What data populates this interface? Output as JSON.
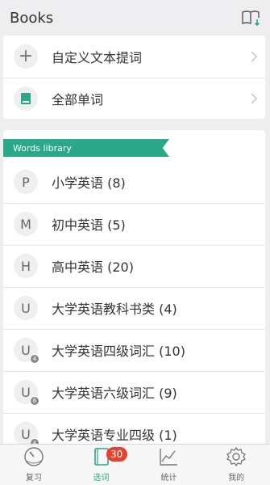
{
  "header": {
    "title": "Books",
    "icon": "book-download-icon"
  },
  "top_menu": [
    {
      "label": "自定义文本提词",
      "icon": "plus-icon"
    },
    {
      "label": "全部单词",
      "icon": "document-icon"
    }
  ],
  "library": {
    "ribbon": "Words library",
    "items": [
      {
        "letter": "P",
        "badge": "",
        "label": "小学英语 (8)"
      },
      {
        "letter": "M",
        "badge": "",
        "label": "初中英语 (5)"
      },
      {
        "letter": "H",
        "badge": "",
        "label": "高中英语 (20)"
      },
      {
        "letter": "U",
        "badge": "",
        "label": "大学英语教科书类 (4)"
      },
      {
        "letter": "U",
        "badge": "4",
        "label": "大学英语四级词汇 (10)"
      },
      {
        "letter": "U",
        "badge": "6",
        "label": "大学英语六级词汇 (9)"
      },
      {
        "letter": "U",
        "badge": "4",
        "label": "大学英语专业四级 (1)"
      }
    ]
  },
  "tabbar": {
    "items": [
      {
        "label": "复习",
        "icon": "gauge-icon"
      },
      {
        "label": "选词",
        "icon": "book-icon",
        "badge": "30",
        "active": true
      },
      {
        "label": "统计",
        "icon": "chart-icon"
      },
      {
        "label": "我的",
        "icon": "gear-icon"
      }
    ]
  },
  "colors": {
    "accent": "#2ba889",
    "badge": "#e5432d"
  }
}
